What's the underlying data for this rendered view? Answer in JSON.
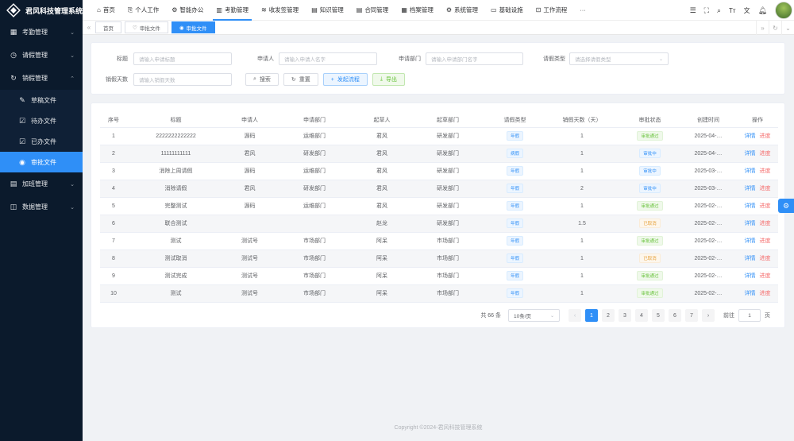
{
  "app": {
    "title": "君风科技管理系统"
  },
  "sidebar": {
    "items": [
      {
        "label": "考勤管理",
        "icon": "calendar-icon",
        "glyph": "▦"
      },
      {
        "label": "请假管理",
        "icon": "clock-icon",
        "glyph": "◷"
      },
      {
        "label": "销假管理",
        "icon": "sync-icon",
        "glyph": "↻"
      }
    ],
    "sub_items": [
      {
        "label": "草稿文件",
        "glyph": "✎"
      },
      {
        "label": "待办文件",
        "glyph": "☑"
      },
      {
        "label": "已办文件",
        "glyph": "☑"
      },
      {
        "label": "审批文件",
        "glyph": "◉"
      }
    ],
    "items_after": [
      {
        "label": "加班管理",
        "icon": "overtime-icon",
        "glyph": "▤"
      },
      {
        "label": "数据管理",
        "icon": "database-icon",
        "glyph": "◫"
      }
    ]
  },
  "topnav": {
    "items": [
      {
        "label": "首页",
        "glyph": "⌂"
      },
      {
        "label": "个人工作",
        "glyph": "⎘"
      },
      {
        "label": "智能办公",
        "glyph": "⚙"
      },
      {
        "label": "考勤管理",
        "glyph": "▥"
      },
      {
        "label": "收发签管理",
        "glyph": "≋"
      },
      {
        "label": "知识管理",
        "glyph": "▤"
      },
      {
        "label": "合同管理",
        "glyph": "▤"
      },
      {
        "label": "档案管理",
        "glyph": "▦"
      },
      {
        "label": "系统管理",
        "glyph": "⚙"
      },
      {
        "label": "基础设施",
        "glyph": "▭"
      },
      {
        "label": "工作流程",
        "glyph": "⊡"
      },
      {
        "label": "···",
        "glyph": ""
      }
    ]
  },
  "tabs": [
    {
      "label": "首页",
      "glyph": ""
    },
    {
      "label": "审批文件",
      "glyph": "♡"
    },
    {
      "label": "审批文件",
      "glyph": "◉"
    }
  ],
  "filters": {
    "title_label": "标题",
    "title_placeholder": "请输入申请标题",
    "applicant_label": "申请人",
    "applicant_placeholder": "请输入申请人名字",
    "dept_label": "申请部门",
    "dept_placeholder": "请输入申请部门名字",
    "type_label": "请假类型",
    "type_placeholder": "请选择请假类型",
    "days_label": "销假天数",
    "days_placeholder": "请输入销假天数",
    "search_btn": "搜索",
    "reset_btn": "重置",
    "start_btn": "发起流程",
    "export_btn": "导出"
  },
  "table": {
    "columns": [
      "序号",
      "标题",
      "申请人",
      "申请部门",
      "起草人",
      "起草部门",
      "请假类型",
      "销假天数（天）",
      "审批状态",
      "创建时间",
      "操作"
    ],
    "rows": [
      {
        "no": "1",
        "title": "2222222222222",
        "applicant": "源码",
        "dept": "运维部门",
        "drafter": "君风",
        "draft_dept": "研发部门",
        "type": "年假",
        "days": "1",
        "status": "审批通过",
        "status_color": "green",
        "time": "2025-04-…"
      },
      {
        "no": "2",
        "title": "11111111111",
        "applicant": "君风",
        "dept": "研发部门",
        "drafter": "君风",
        "draft_dept": "研发部门",
        "type": "病假",
        "days": "1",
        "status": "审批中",
        "status_color": "blue",
        "time": "2025-04-…"
      },
      {
        "no": "3",
        "title": "消除上周请假",
        "applicant": "源码",
        "dept": "运维部门",
        "drafter": "君风",
        "draft_dept": "研发部门",
        "type": "年假",
        "days": "1",
        "status": "审批中",
        "status_color": "blue",
        "time": "2025-03-…"
      },
      {
        "no": "4",
        "title": "消除请假",
        "applicant": "君风",
        "dept": "研发部门",
        "drafter": "君风",
        "draft_dept": "研发部门",
        "type": "年假",
        "days": "2",
        "status": "审批中",
        "status_color": "blue",
        "time": "2025-03-…"
      },
      {
        "no": "5",
        "title": "完整测试",
        "applicant": "源码",
        "dept": "运维部门",
        "drafter": "君风",
        "draft_dept": "研发部门",
        "type": "年假",
        "days": "1",
        "status": "审批通过",
        "status_color": "green",
        "time": "2025-02-…"
      },
      {
        "no": "6",
        "title": "联合测试",
        "applicant": "",
        "dept": "",
        "drafter": "赵龙",
        "draft_dept": "研发部门",
        "type": "年假",
        "days": "1.5",
        "status": "已取消",
        "status_color": "orange",
        "time": "2025-02-…"
      },
      {
        "no": "7",
        "title": "测试",
        "applicant": "测试号",
        "dept": "市场部门",
        "drafter": "阿呆",
        "draft_dept": "市场部门",
        "type": "年假",
        "days": "1",
        "status": "审批通过",
        "status_color": "green",
        "time": "2025-02-…"
      },
      {
        "no": "8",
        "title": "测试取消",
        "applicant": "测试号",
        "dept": "市场部门",
        "drafter": "阿呆",
        "draft_dept": "市场部门",
        "type": "年假",
        "days": "1",
        "status": "已取消",
        "status_color": "orange",
        "time": "2025-02-…"
      },
      {
        "no": "9",
        "title": "测试完成",
        "applicant": "测试号",
        "dept": "市场部门",
        "drafter": "阿呆",
        "draft_dept": "市场部门",
        "type": "年假",
        "days": "1",
        "status": "审批通过",
        "status_color": "green",
        "time": "2025-02-…"
      },
      {
        "no": "10",
        "title": "测试",
        "applicant": "测试号",
        "dept": "市场部门",
        "drafter": "阿呆",
        "draft_dept": "市场部门",
        "type": "年假",
        "days": "1",
        "status": "审批通过",
        "status_color": "green",
        "time": "2025-02-…"
      }
    ],
    "action_detail": "详情",
    "action_progress": "进度"
  },
  "pagination": {
    "total": "共 66 条",
    "page_size": "10条/页",
    "pages": [
      "1",
      "2",
      "3",
      "4",
      "5",
      "6",
      "7"
    ],
    "prev": "‹",
    "next": "›",
    "goto_label": "前往",
    "goto_value": "1",
    "goto_unit": "页"
  },
  "footer": {
    "text": "Copyright ©2024-君风科技管理系统"
  },
  "colors": {
    "accent": "#2f8ff7",
    "sidebar_bg": "#0b1a2c",
    "danger": "#f56c6c"
  }
}
